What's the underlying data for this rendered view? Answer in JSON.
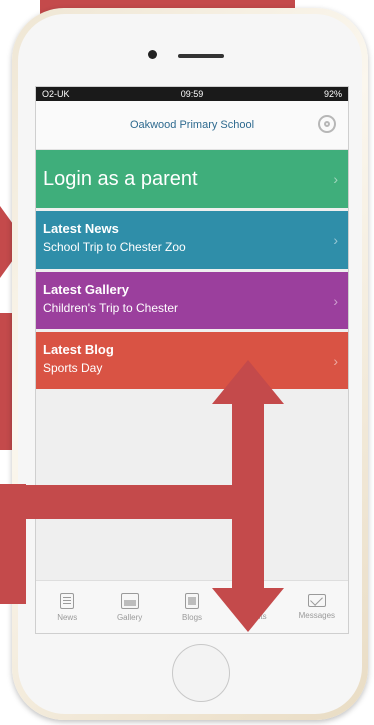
{
  "status": {
    "carrier": "O2-UK",
    "time": "09:59",
    "battery": "92%"
  },
  "header": {
    "title": "Oakwood Primary School"
  },
  "tiles": [
    {
      "heading": "Login as a parent"
    },
    {
      "heading": "Latest News",
      "subtitle": "School Trip to Chester Zoo"
    },
    {
      "heading": "Latest Gallery",
      "subtitle": "Children's Trip to Chester"
    },
    {
      "heading": "Latest Blog",
      "subtitle": "Sports Day"
    }
  ],
  "tabs": [
    {
      "label": "News"
    },
    {
      "label": "Gallery"
    },
    {
      "label": "Blogs"
    },
    {
      "label": "Events"
    },
    {
      "label": "Messages"
    }
  ],
  "colors": {
    "login": "#3fae7b",
    "news": "#2f8ea9",
    "gallery": "#9b3f9d",
    "blog": "#d95344",
    "annotation": "#c44a4b"
  },
  "icons": [
    "settings-gear-icon",
    "chevron-right-icon",
    "news-icon",
    "gallery-icon",
    "blogs-icon",
    "events-icon",
    "messages-icon"
  ]
}
